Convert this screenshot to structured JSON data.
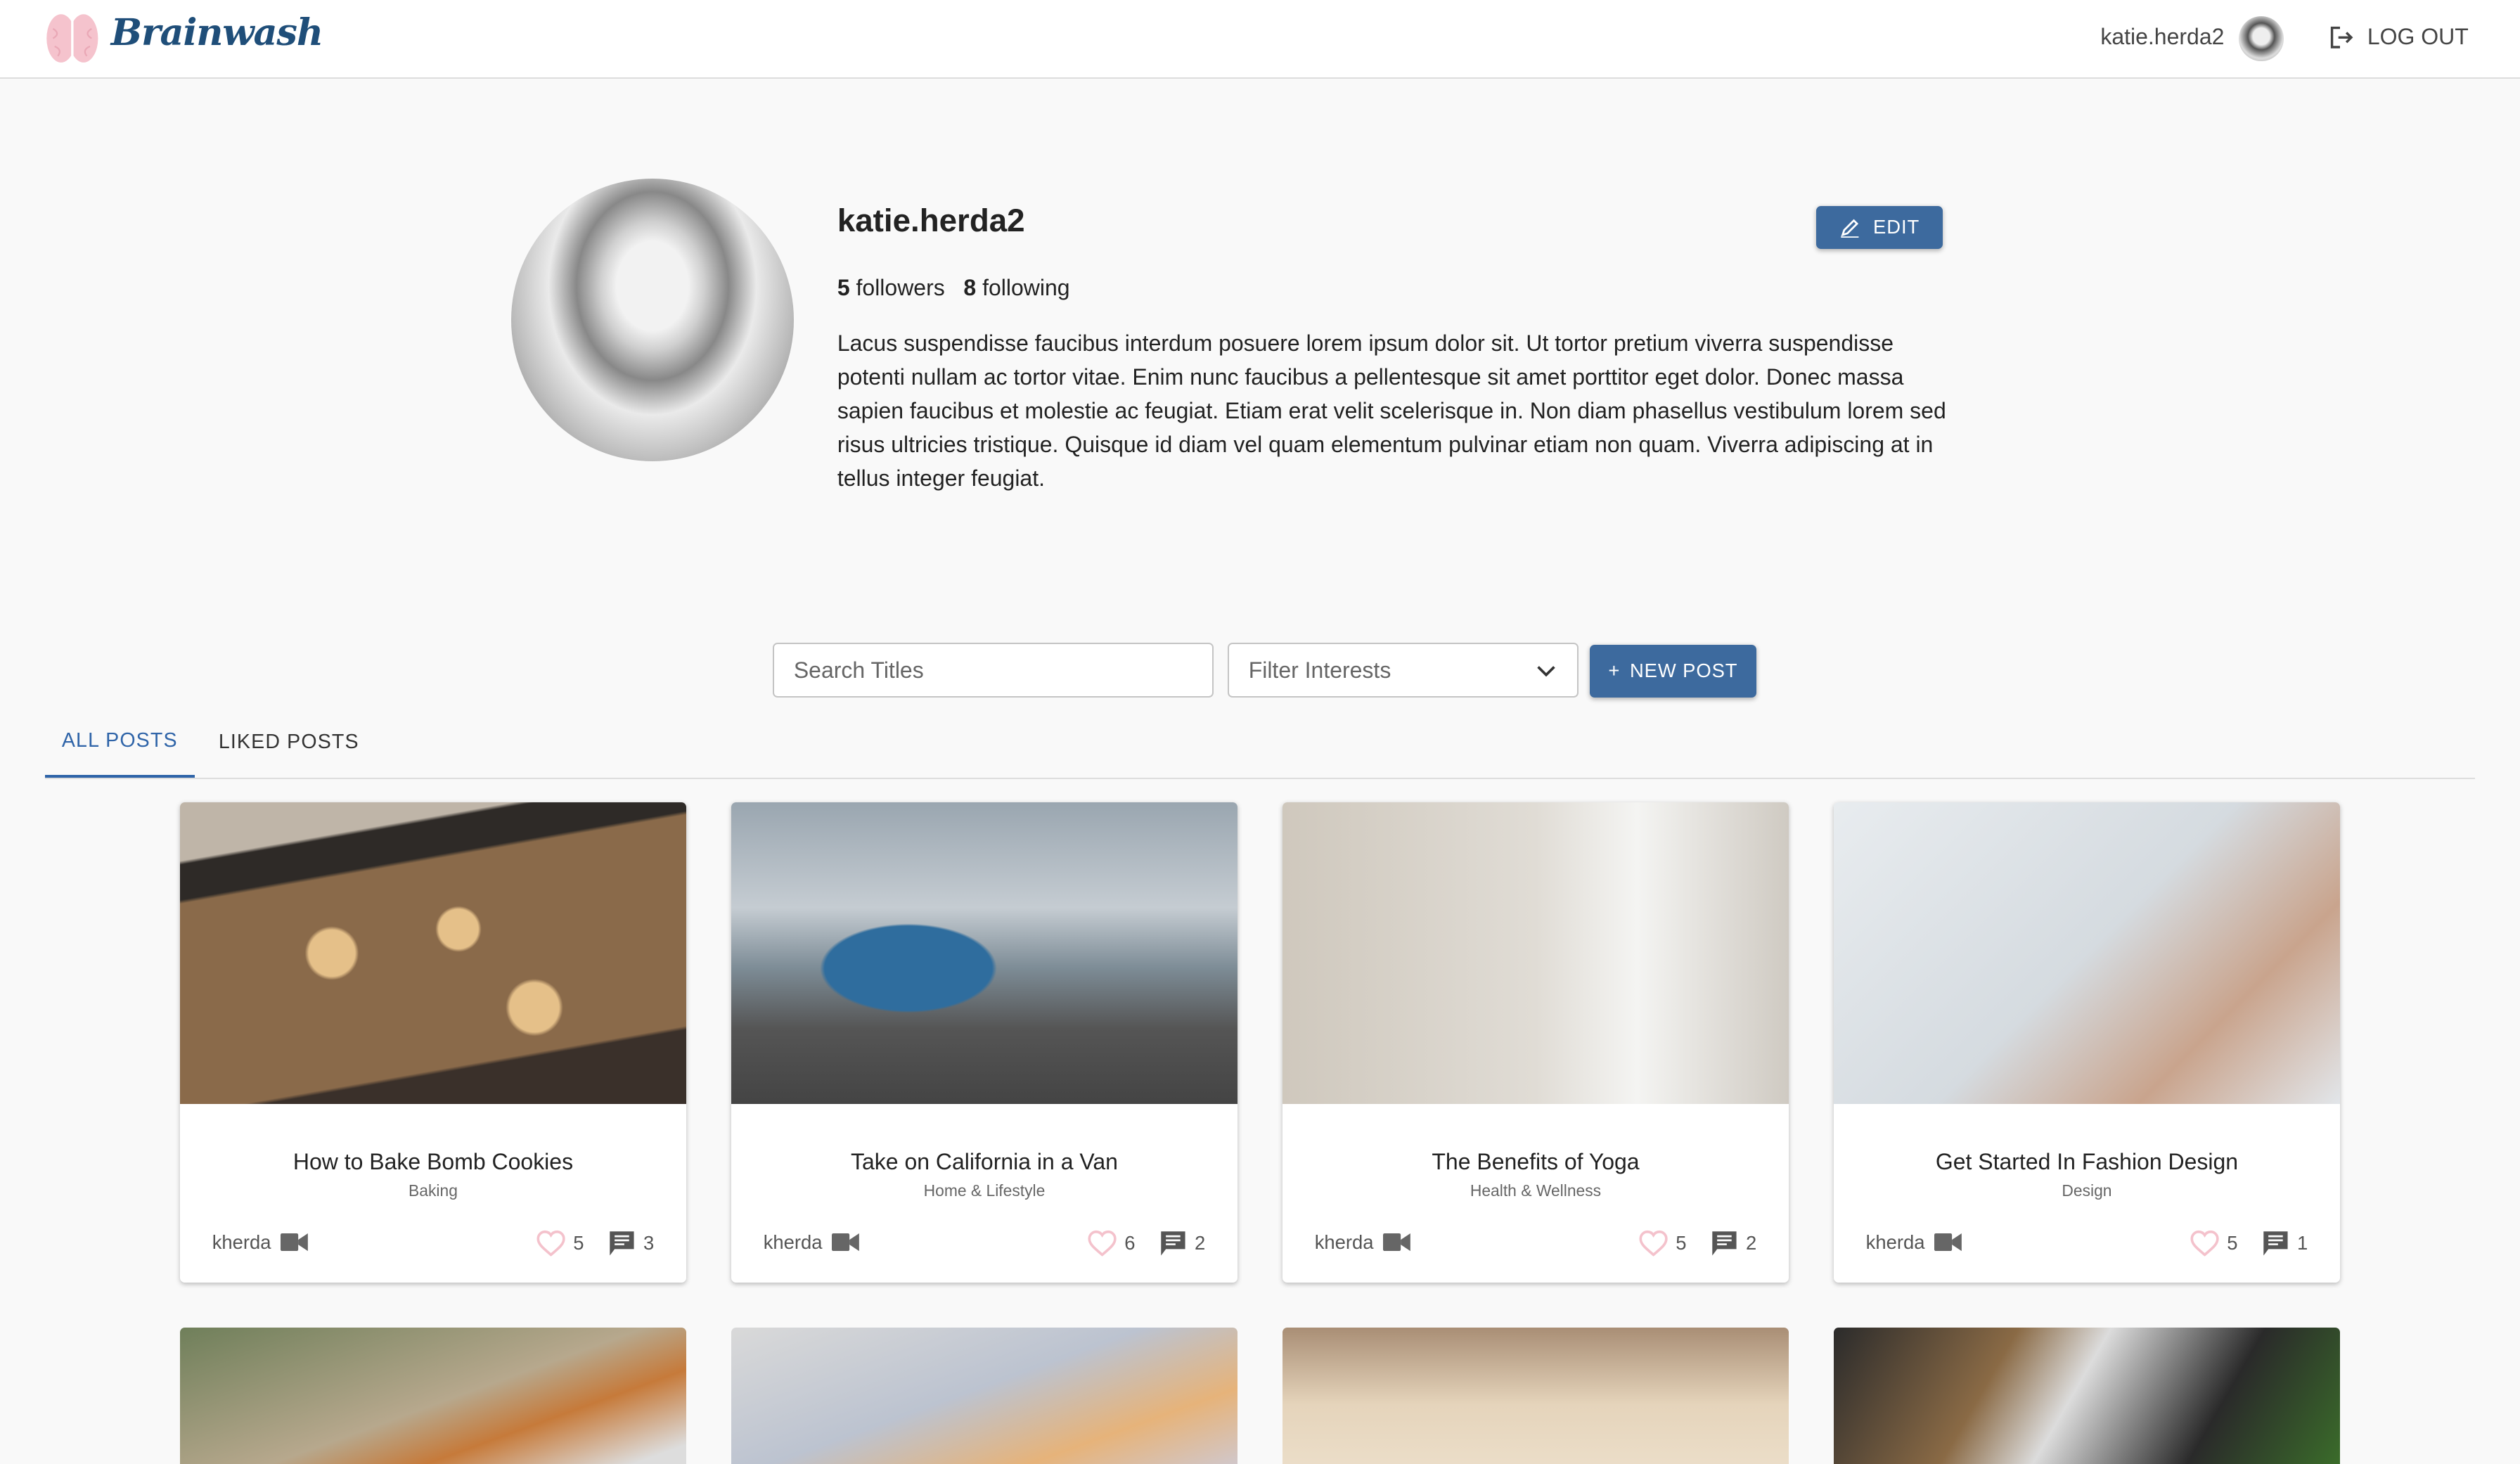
{
  "header": {
    "logo": "Brainwash",
    "username": "katie.herda2",
    "logout_label": "LOG OUT"
  },
  "profile": {
    "name": "katie.herda2",
    "followers_count": "5",
    "followers_label": "followers",
    "following_count": "8",
    "following_label": "following",
    "edit_label": "EDIT",
    "bio": "Lacus suspendisse faucibus interdum posuere lorem ipsum dolor sit. Ut tortor pretium viverra suspendisse potenti nullam ac tortor vitae. Enim nunc faucibus a pellentesque sit amet porttitor eget dolor. Donec massa sapien faucibus et molestie ac feugiat. Etiam erat velit scelerisque in. Non diam phasellus vestibulum lorem sed risus ultricies tristique. Quisque id diam vel quam elementum pulvinar etiam non quam. Viverra adipiscing at in tellus integer feugiat."
  },
  "toolbar": {
    "search_placeholder": "Search Titles",
    "filter_placeholder": "Filter Interests",
    "new_post_label": "NEW POST"
  },
  "tabs": [
    {
      "label": "ALL POSTS",
      "active": true
    },
    {
      "label": "LIKED POSTS",
      "active": false
    }
  ],
  "colors": {
    "primary": "#3d6a9e",
    "tab_active": "#2f64a8",
    "logo": "#1f4e79",
    "heart": "#f4c2cc"
  },
  "posts": [
    {
      "title": "How to Bake Bomb Cookies",
      "category": "Baking",
      "author": "kherda",
      "likes": "5",
      "comments": "3"
    },
    {
      "title": "Take on California in a Van",
      "category": "Home & Lifestyle",
      "author": "kherda",
      "likes": "6",
      "comments": "2"
    },
    {
      "title": "The Benefits of Yoga",
      "category": "Health & Wellness",
      "author": "kherda",
      "likes": "5",
      "comments": "2"
    },
    {
      "title": "Get Started In Fashion Design",
      "category": "Design",
      "author": "kherda",
      "likes": "5",
      "comments": "1"
    }
  ]
}
